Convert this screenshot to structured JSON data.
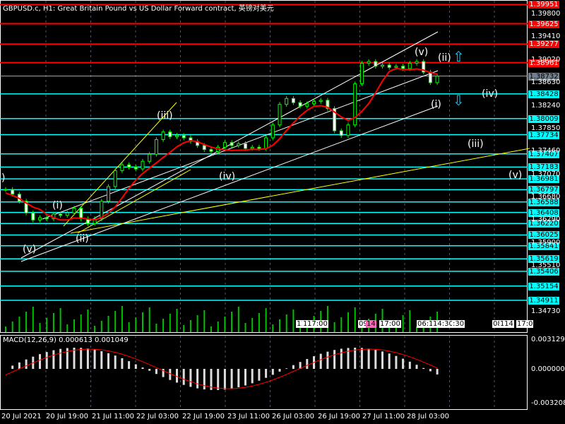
{
  "title": "GBPUSD.c, H1:  Great Britain Pound vs US Dollar Forward contract, 英镑对美元",
  "macd_label": "MACD(12,26,9) 0.000613 0.001049",
  "colors": {
    "red": "#ff0000",
    "cyan": "#00ffff",
    "bid": "#708090",
    "candle": "#00ff00",
    "ma": "#ff0000",
    "volume": "#00c000",
    "macd_hist": "#c0c0c0"
  },
  "red_levels": [
    "1.39951",
    "1.39625",
    "1.39277",
    "1.38961"
  ],
  "bid_level": "1.38732",
  "cyan_levels": [
    "1.38428",
    "1.38009",
    "1.37734",
    "1.37407",
    "1.37183",
    "1.36981",
    "1.36797",
    "1.36588",
    "1.36408",
    "1.36220",
    "1.36025",
    "1.35841",
    "1.35619",
    "1.35406",
    "1.35154",
    "1.34911"
  ],
  "price_ticks": [
    "1.39800",
    "1.39410",
    "1.39020",
    "1.38630",
    "1.38240",
    "1.37850",
    "1.37460",
    "1.37070",
    "1.36680",
    "1.36290",
    "1.35900",
    "1.35510",
    "1.34730"
  ],
  "macd_ticks": [
    "0.003129",
    "0.000000",
    "-0.003208"
  ],
  "time_labels": [
    "20 Jul 2021",
    "20 Jul 19:00",
    "21 Jul 11:00",
    "22 Jul 03:00",
    "22 Jul 19:00",
    "23 Jul 11:00",
    "26 Jul 03:00",
    "26 Jul 19:00",
    "27 Jul 11:00",
    "28 Jul 03:00"
  ],
  "event_labels": [
    "11",
    "1",
    "17:00",
    "09",
    "14",
    "17:00",
    "06:00",
    "1",
    "14:30",
    ":30",
    "08:",
    "1",
    "14",
    "17:0"
  ],
  "waves": [
    ")",
    "(v)",
    "(i)",
    "(ii)",
    "(iii)",
    "(iv)",
    "(v)",
    "(ii)",
    "(i)",
    "(iv)",
    "(iii)",
    "(v)"
  ],
  "chart_data": {
    "type": "candlestick",
    "symbol": "GBPUSD.c",
    "timeframe": "H1",
    "closes": [
      1.368,
      1.3672,
      1.366,
      1.364,
      1.3628,
      1.3632,
      1.363,
      1.3638,
      1.3636,
      1.364,
      1.3648,
      1.363,
      1.3622,
      1.363,
      1.366,
      1.3685,
      1.3712,
      1.3722,
      1.3718,
      1.3715,
      1.3728,
      1.374,
      1.3765,
      1.3778,
      1.377,
      1.3772,
      1.3768,
      1.3762,
      1.3755,
      1.3748,
      1.3745,
      1.3752,
      1.376,
      1.3755,
      1.3758,
      1.375,
      1.3752,
      1.375,
      1.3768,
      1.379,
      1.3825,
      1.3835,
      1.3828,
      1.3822,
      1.3826,
      1.383,
      1.3832,
      1.3818,
      1.378,
      1.3772,
      1.379,
      1.386,
      1.3895,
      1.3898,
      1.389,
      1.3892,
      1.3888,
      1.389,
      1.3886,
      1.3895,
      1.3898,
      1.388,
      1.3862,
      1.3873
    ],
    "ylim": [
      1.345,
      1.401
    ]
  }
}
